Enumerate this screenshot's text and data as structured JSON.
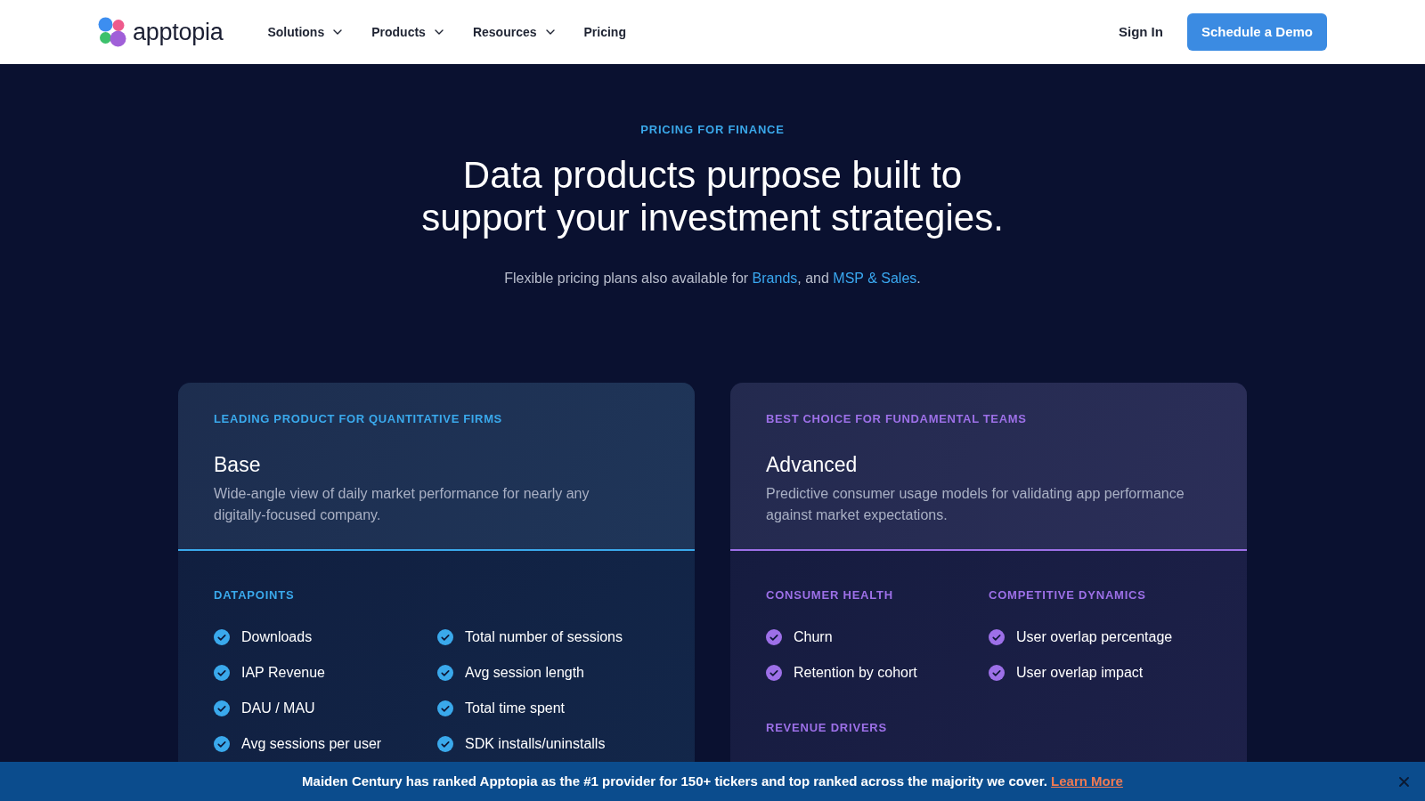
{
  "header": {
    "logo": "apptopia",
    "nav": [
      {
        "label": "Solutions",
        "dropdown": true
      },
      {
        "label": "Products",
        "dropdown": true
      },
      {
        "label": "Resources",
        "dropdown": true
      },
      {
        "label": "Pricing",
        "dropdown": false
      }
    ],
    "sign_in": "Sign In",
    "cta": "Schedule a Demo"
  },
  "hero": {
    "eyebrow": "PRICING FOR FINANCE",
    "heading": "Data products purpose built to support your investment strategies.",
    "subtitle": [
      {
        "kind": "text",
        "text": "Flexible pricing plans also available for "
      },
      {
        "kind": "link",
        "text": "Brands"
      },
      {
        "kind": "text",
        "text": ", and "
      },
      {
        "kind": "link",
        "text": "MSP & Sales"
      },
      {
        "kind": "text",
        "text": "."
      }
    ]
  },
  "plans": [
    {
      "tag": "LEADING PRODUCT FOR QUANTITATIVE FIRMS",
      "title": "Base",
      "description": "Wide-angle view of daily market performance for nearly any digitally-focused company.",
      "color": "#3aa9ec",
      "sections": [
        {
          "kind": "wide",
          "heading": "DATAPOINTS",
          "items": [
            "Downloads",
            "IAP Revenue",
            "DAU / MAU",
            "Avg sessions per user",
            "Total number of sessions",
            "Avg session length",
            "Total time spent",
            "SDK installs/uninstalls"
          ]
        }
      ]
    },
    {
      "tag": "BEST CHOICE FOR FUNDAMENTAL TEAMS",
      "title": "Advanced",
      "description": "Predictive consumer usage models for validating app performance against market expectations.",
      "color": "#9d70e8",
      "sections": [
        {
          "kind": "half",
          "heading": "CONSUMER HEALTH",
          "items": [
            "Churn",
            "Retention by cohort"
          ]
        },
        {
          "kind": "half",
          "heading": "COMPETITIVE DYNAMICS",
          "items": [
            "User overlap percentage",
            "User overlap impact"
          ]
        },
        {
          "kind": "half",
          "heading": "REVENUE DRIVERS"
        }
      ]
    }
  ],
  "banner": {
    "message": "Maiden Century has ranked Apptopia as the #1 provider for 150+ tickers and top ranked across the majority we cover.",
    "link": "Learn More"
  }
}
